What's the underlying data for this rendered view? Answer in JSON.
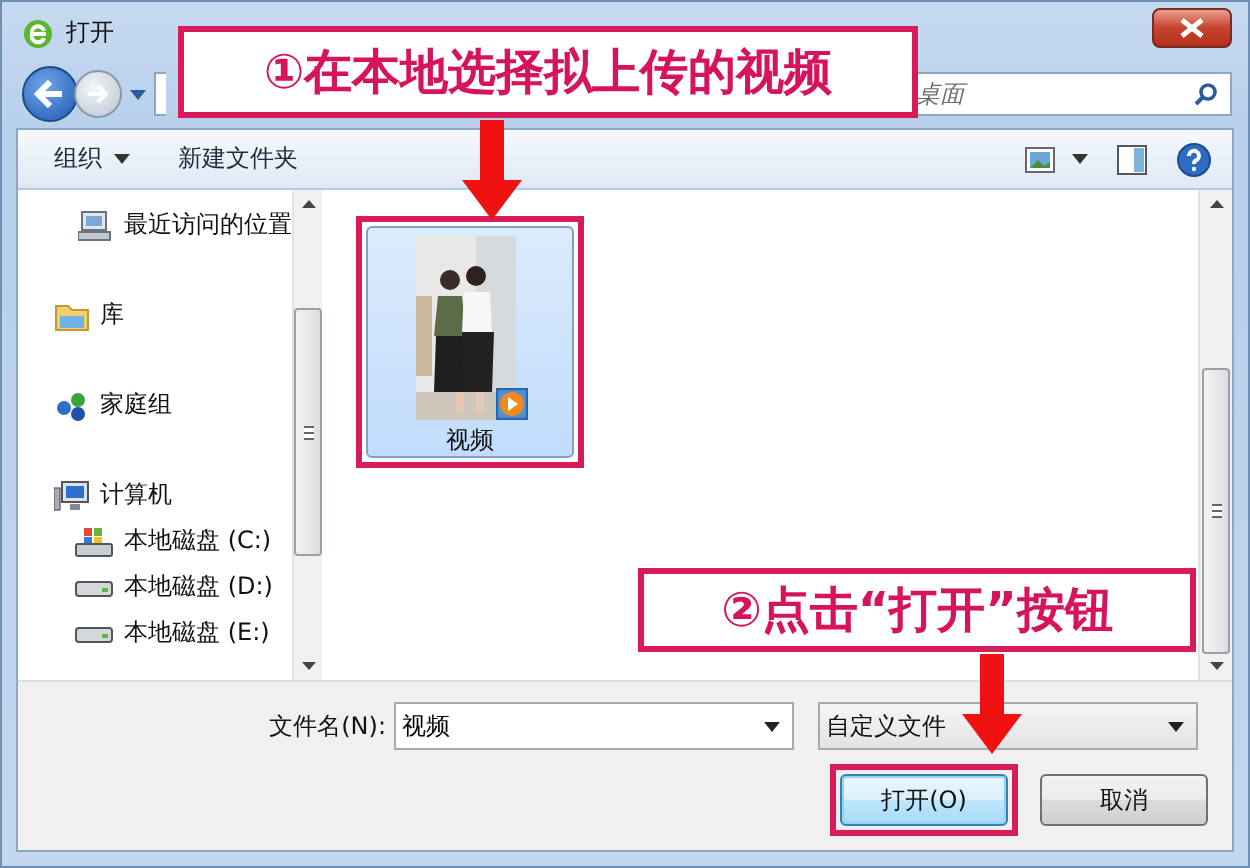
{
  "window": {
    "title": "打开"
  },
  "search": {
    "placeholder": "桌面"
  },
  "toolbar": {
    "buttons": [
      {
        "label": "组织",
        "kind": "menu"
      },
      {
        "label": "新建文件夹",
        "kind": "plain"
      }
    ]
  },
  "sidebar": {
    "items": [
      {
        "label": "最近访问的位置",
        "kind": "recent"
      },
      {
        "label": "库",
        "kind": "library"
      },
      {
        "label": "家庭组",
        "kind": "homegroup"
      },
      {
        "label": "计算机",
        "kind": "computer",
        "children": [
          {
            "label": "本地磁盘 (C:)",
            "kind": "system-drive"
          },
          {
            "label": "本地磁盘 (D:)",
            "kind": "drive"
          },
          {
            "label": "本地磁盘 (E:)",
            "kind": "drive"
          }
        ]
      }
    ]
  },
  "files": [
    {
      "name": "视频",
      "kind": "video",
      "selected": true
    }
  ],
  "filename": {
    "label": "文件名(N):",
    "value": "视频"
  },
  "filter": {
    "value": "自定义文件"
  },
  "buttons": [
    {
      "label": "打开(O)",
      "kind": "primary"
    },
    {
      "label": "取消",
      "kind": "normal"
    }
  ],
  "annotations": [
    {
      "text": "①在本地选择拟上传的视频",
      "kind": "top"
    },
    {
      "text": "②点击“打开”按钮",
      "kind": "bottom"
    }
  ]
}
